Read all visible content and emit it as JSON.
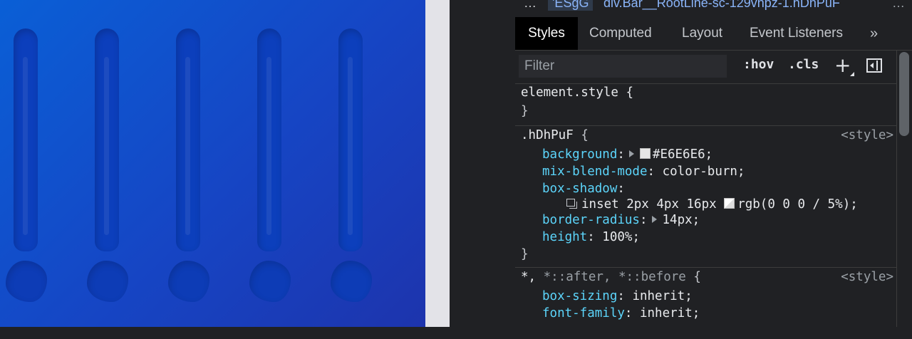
{
  "breadcrumbs": {
    "overflow_left": "…",
    "items": [
      "'ESgG",
      "div.Bar__RootLine-sc-129vhpz-1.hDhPuF"
    ],
    "overflow_right": "…"
  },
  "tabs": [
    {
      "label": "Styles",
      "active": true
    },
    {
      "label": "Computed",
      "active": false
    },
    {
      "label": "Layout",
      "active": false
    },
    {
      "label": "Event Listeners",
      "active": false
    },
    {
      "label": "»",
      "active": false
    }
  ],
  "filter": {
    "placeholder": "Filter",
    "value": ""
  },
  "toolbar": {
    "hov": ":hov",
    "cls": ".cls",
    "add": "+"
  },
  "rules": {
    "element": {
      "selector": "element.style {",
      "close": "}"
    },
    "hdhpuf": {
      "selector": ".hDhPuF",
      "open": "{",
      "source": "<style>",
      "background_prop": "background",
      "background_val": "#E6E6E6",
      "blend_prop": "mix-blend-mode",
      "blend_val": "color-burn",
      "shadow_prop": "box-shadow",
      "shadow_val_a": "inset 2px 4px 16px",
      "shadow_val_b": "rgb(0 0 0 / 5%)",
      "radius_prop": "border-radius",
      "radius_val": "14px",
      "height_prop": "height",
      "height_val": "100%",
      "close": "}"
    },
    "universal": {
      "selector_a": "*,",
      "selector_b": "*::after, *::before",
      "open": "{",
      "source": "<style>",
      "boxsizing_prop": "box-sizing",
      "boxsizing_val": "inherit",
      "font_prop": "font-family",
      "font_val": "inherit"
    }
  },
  "colors": {
    "preview_gradient_start": "#0a5fd6",
    "preview_gradient_end": "#1d34ad",
    "property_name": "#5cd5fb",
    "link": "#8ab4f8",
    "devtools_bg": "#202124"
  }
}
